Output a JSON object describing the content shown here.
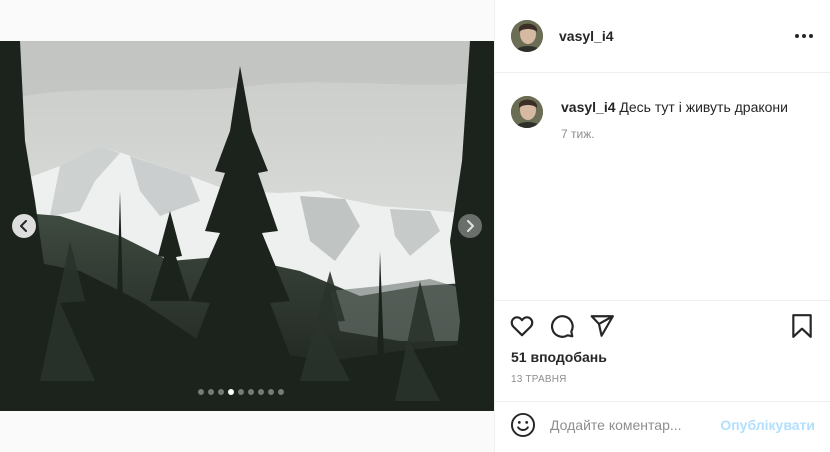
{
  "post": {
    "username": "vasyl_i4",
    "caption": "Десь тут і живуть дракони",
    "comment_time": "7 тиж.",
    "likes": "51 вподобань",
    "date": "13 ТРАВНЯ",
    "comment_placeholder": "Додайте коментар...",
    "publish_label": "Опублікувати"
  },
  "media": {
    "alt": "Mountain landscape with snowy peaks and pine trees",
    "carousel_total": 9,
    "carousel_active": 4
  },
  "icons": {
    "more": "more-horizontal-icon",
    "like": "heart-icon",
    "comment": "comment-icon",
    "share": "send-icon",
    "save": "bookmark-icon",
    "emoji": "smile-icon",
    "prev": "chevron-left-icon",
    "next": "chevron-right-icon"
  }
}
